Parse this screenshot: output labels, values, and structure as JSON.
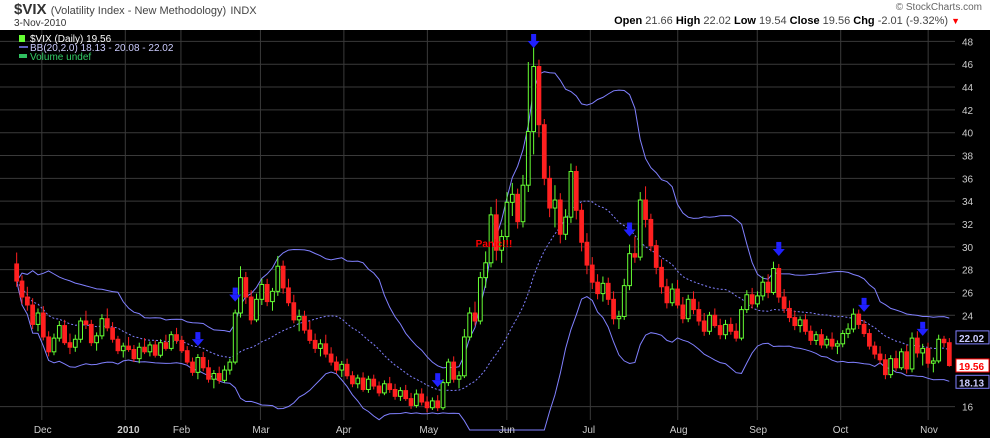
{
  "header": {
    "symbol": "$VIX",
    "name": "(Volatility Index - New Methodology)",
    "exchange": "INDX",
    "date": "3-Nov-2010",
    "copyright": "© StockCharts.com",
    "open_label": "Open",
    "open": "21.66",
    "high_label": "High",
    "high": "22.02",
    "low_label": "Low",
    "low": "19.54",
    "close_label": "Close",
    "close": "19.56",
    "chg_label": "Chg",
    "chg": "-2.01 (-9.32%)"
  },
  "legend": {
    "vix": "$VIX (Daily) 19.56",
    "bb": "BB(20,2.0) 18.13 - 20.08 - 22.02",
    "volume": "Volume undef"
  },
  "colors": {
    "background": "#000000",
    "grid": "#3a3a3a",
    "up": "#66ff33",
    "down": "#ff2020",
    "band": "#8080ff",
    "mid": "#8080ff",
    "arrow": "#2020ff",
    "annotation": "#ff0000",
    "axis_text": "#cccccc"
  },
  "chart_data": {
    "type": "candlestick",
    "title": "$VIX (Daily)",
    "ylim": [
      15,
      49
    ],
    "ticks_y": [
      16,
      24,
      26,
      28,
      30,
      32,
      34,
      36,
      38,
      40,
      42,
      44,
      46,
      48
    ],
    "months": [
      "Dec",
      "2010",
      "Feb",
      "Mar",
      "Apr",
      "May",
      "Jun",
      "Jul",
      "Aug",
      "Sep",
      "Oct",
      "Nov"
    ],
    "series": [
      {
        "name": "$VIX",
        "ohlc": [
          [
            28.5,
            29.5,
            26.5,
            27.0
          ],
          [
            27.0,
            27.5,
            25.0,
            25.6
          ],
          [
            25.6,
            26.5,
            24.4,
            24.9
          ],
          [
            24.9,
            25.5,
            22.8,
            23.2
          ],
          [
            23.2,
            24.6,
            22.6,
            24.2
          ],
          [
            24.2,
            24.8,
            21.8,
            22.1
          ],
          [
            22.1,
            22.6,
            20.4,
            20.8
          ],
          [
            20.8,
            22.4,
            20.5,
            22.0
          ],
          [
            22.0,
            23.5,
            21.7,
            23.1
          ],
          [
            23.1,
            23.6,
            21.4,
            21.6
          ],
          [
            21.6,
            22.4,
            20.6,
            21.2
          ],
          [
            21.2,
            22.3,
            20.8,
            21.9
          ],
          [
            21.9,
            23.8,
            21.6,
            23.5
          ],
          [
            23.5,
            24.4,
            22.8,
            23.2
          ],
          [
            23.2,
            23.6,
            21.3,
            21.6
          ],
          [
            21.6,
            22.5,
            20.9,
            22.2
          ],
          [
            22.2,
            24.1,
            21.9,
            23.7
          ],
          [
            23.7,
            24.6,
            22.6,
            22.9
          ],
          [
            22.9,
            23.4,
            21.6,
            21.9
          ],
          [
            21.9,
            22.2,
            20.6,
            20.9
          ],
          [
            20.9,
            21.6,
            20.3,
            21.3
          ],
          [
            21.3,
            22.1,
            20.8,
            21.0
          ],
          [
            21.0,
            21.4,
            19.9,
            20.2
          ],
          [
            20.2,
            21.6,
            19.8,
            21.2
          ],
          [
            21.2,
            22.0,
            20.6,
            20.8
          ],
          [
            20.8,
            21.7,
            20.4,
            21.4
          ],
          [
            21.4,
            21.8,
            20.3,
            20.5
          ],
          [
            20.5,
            21.9,
            20.3,
            21.6
          ],
          [
            21.6,
            22.3,
            20.9,
            21.1
          ],
          [
            21.1,
            22.6,
            20.9,
            22.3
          ],
          [
            22.3,
            22.9,
            21.5,
            21.8
          ],
          [
            21.8,
            22.2,
            20.7,
            20.9
          ],
          [
            20.9,
            21.3,
            19.7,
            19.9
          ],
          [
            19.9,
            20.3,
            18.7,
            19.0
          ],
          [
            19.0,
            20.6,
            18.4,
            20.3
          ],
          [
            20.3,
            20.8,
            19.1,
            19.4
          ],
          [
            19.4,
            20.1,
            18.1,
            18.4
          ],
          [
            18.4,
            19.2,
            17.6,
            18.9
          ],
          [
            18.9,
            19.5,
            18.0,
            18.3
          ],
          [
            18.3,
            19.6,
            18.1,
            19.2
          ],
          [
            19.2,
            20.2,
            18.8,
            19.9
          ],
          [
            19.9,
            24.5,
            19.7,
            24.2
          ],
          [
            24.2,
            28.3,
            23.8,
            27.3
          ],
          [
            27.3,
            27.8,
            25.0,
            25.6
          ],
          [
            25.6,
            26.2,
            23.2,
            23.6
          ],
          [
            23.6,
            25.9,
            23.4,
            25.4
          ],
          [
            25.4,
            27.2,
            24.9,
            26.7
          ],
          [
            26.7,
            27.2,
            24.8,
            25.2
          ],
          [
            25.2,
            26.4,
            24.4,
            26.1
          ],
          [
            26.1,
            29.2,
            25.7,
            28.3
          ],
          [
            28.3,
            28.8,
            25.9,
            26.4
          ],
          [
            26.4,
            27.2,
            24.8,
            25.1
          ],
          [
            25.1,
            25.8,
            23.3,
            23.6
          ],
          [
            23.6,
            24.5,
            22.6,
            23.9
          ],
          [
            23.9,
            24.4,
            22.4,
            22.7
          ],
          [
            22.7,
            23.5,
            21.5,
            21.8
          ],
          [
            21.8,
            22.4,
            20.7,
            21.1
          ],
          [
            21.1,
            21.9,
            20.4,
            21.5
          ],
          [
            21.5,
            22.3,
            20.3,
            20.6
          ],
          [
            20.6,
            21.2,
            19.6,
            19.9
          ],
          [
            19.9,
            20.4,
            18.9,
            19.2
          ],
          [
            19.2,
            20.0,
            18.6,
            19.7
          ],
          [
            19.7,
            20.2,
            18.4,
            18.7
          ],
          [
            18.7,
            19.1,
            17.7,
            18.0
          ],
          [
            18.0,
            18.8,
            17.6,
            18.5
          ],
          [
            18.5,
            19.0,
            17.3,
            17.5
          ],
          [
            17.5,
            18.7,
            17.2,
            18.4
          ],
          [
            18.4,
            18.8,
            17.5,
            17.8
          ],
          [
            17.8,
            18.2,
            16.9,
            17.2
          ],
          [
            17.2,
            18.3,
            17.0,
            18.0
          ],
          [
            18.0,
            18.6,
            17.2,
            17.5
          ],
          [
            17.5,
            18.0,
            16.6,
            16.9
          ],
          [
            16.9,
            17.7,
            16.5,
            17.4
          ],
          [
            17.4,
            17.9,
            16.5,
            16.7
          ],
          [
            16.7,
            17.2,
            15.8,
            16.1
          ],
          [
            16.1,
            17.5,
            15.9,
            17.1
          ],
          [
            17.1,
            17.6,
            16.1,
            16.4
          ],
          [
            16.4,
            16.9,
            15.5,
            15.9
          ],
          [
            15.9,
            16.8,
            15.7,
            16.5
          ],
          [
            16.5,
            17.0,
            15.6,
            15.9
          ],
          [
            15.9,
            18.4,
            15.7,
            18.1
          ],
          [
            18.1,
            20.2,
            17.8,
            19.9
          ],
          [
            19.9,
            20.4,
            18.1,
            18.4
          ],
          [
            18.4,
            19.1,
            17.6,
            18.7
          ],
          [
            18.7,
            22.8,
            18.5,
            22.1
          ],
          [
            22.1,
            24.7,
            21.8,
            24.2
          ],
          [
            24.2,
            25.2,
            23.1,
            23.5
          ],
          [
            23.5,
            27.8,
            23.2,
            27.3
          ],
          [
            27.3,
            29.6,
            26.4,
            28.6
          ],
          [
            28.6,
            33.5,
            28.2,
            32.8
          ],
          [
            32.8,
            34.2,
            28.8,
            29.7
          ],
          [
            29.7,
            31.5,
            28.6,
            30.9
          ],
          [
            30.9,
            34.8,
            30.4,
            33.9
          ],
          [
            33.9,
            35.6,
            32.7,
            34.6
          ],
          [
            34.6,
            35.1,
            31.6,
            32.2
          ],
          [
            32.2,
            36.3,
            31.7,
            35.4
          ],
          [
            35.4,
            46.2,
            34.8,
            40.1
          ],
          [
            40.1,
            48.2,
            38.1,
            45.8
          ],
          [
            45.8,
            46.4,
            39.6,
            40.7
          ],
          [
            40.7,
            41.2,
            35.4,
            36.0
          ],
          [
            36.0,
            37.1,
            32.6,
            33.4
          ],
          [
            33.4,
            35.4,
            31.7,
            34.1
          ],
          [
            34.1,
            34.7,
            30.3,
            31.1
          ],
          [
            31.1,
            33.3,
            30.6,
            32.6
          ],
          [
            32.6,
            37.3,
            32.1,
            36.6
          ],
          [
            36.6,
            37.1,
            32.4,
            33.2
          ],
          [
            33.2,
            33.8,
            29.6,
            30.4
          ],
          [
            30.4,
            31.2,
            27.6,
            28.4
          ],
          [
            28.4,
            29.1,
            26.3,
            26.9
          ],
          [
            26.9,
            27.6,
            25.4,
            25.9
          ],
          [
            25.9,
            27.4,
            25.2,
            26.8
          ],
          [
            26.8,
            27.3,
            24.9,
            25.4
          ],
          [
            25.4,
            26.1,
            23.2,
            23.7
          ],
          [
            23.7,
            24.4,
            22.8,
            23.9
          ],
          [
            23.9,
            27.2,
            23.6,
            26.6
          ],
          [
            26.6,
            30.2,
            26.2,
            29.4
          ],
          [
            29.4,
            30.9,
            28.6,
            29.1
          ],
          [
            29.1,
            34.8,
            28.8,
            34.1
          ],
          [
            34.1,
            35.3,
            31.7,
            32.4
          ],
          [
            32.4,
            32.9,
            29.6,
            30.1
          ],
          [
            30.1,
            30.6,
            27.6,
            28.2
          ],
          [
            28.2,
            28.9,
            25.9,
            26.5
          ],
          [
            26.5,
            27.2,
            24.6,
            25.1
          ],
          [
            25.1,
            26.8,
            24.8,
            26.3
          ],
          [
            26.3,
            27.1,
            24.6,
            24.9
          ],
          [
            24.9,
            25.6,
            23.3,
            23.7
          ],
          [
            23.7,
            25.8,
            23.4,
            25.4
          ],
          [
            25.4,
            26.1,
            24.1,
            24.5
          ],
          [
            24.5,
            25.2,
            23.1,
            23.5
          ],
          [
            23.5,
            24.2,
            22.2,
            22.6
          ],
          [
            22.6,
            24.3,
            22.3,
            24.0
          ],
          [
            24.0,
            24.6,
            22.9,
            23.1
          ],
          [
            23.1,
            23.7,
            21.9,
            22.3
          ],
          [
            22.3,
            23.6,
            21.9,
            23.2
          ],
          [
            23.2,
            23.8,
            22.3,
            22.6
          ],
          [
            22.6,
            23.3,
            21.7,
            22.0
          ],
          [
            22.0,
            24.8,
            21.8,
            24.5
          ],
          [
            24.5,
            26.2,
            24.2,
            25.8
          ],
          [
            25.8,
            26.4,
            24.6,
            25.0
          ],
          [
            25.0,
            26.1,
            24.7,
            25.7
          ],
          [
            25.7,
            27.4,
            25.3,
            26.9
          ],
          [
            26.9,
            27.6,
            25.5,
            26.0
          ],
          [
            26.0,
            28.7,
            25.8,
            28.1
          ],
          [
            28.1,
            28.5,
            25.1,
            25.6
          ],
          [
            25.6,
            26.3,
            24.2,
            24.6
          ],
          [
            24.6,
            25.3,
            23.4,
            23.8
          ],
          [
            23.8,
            24.4,
            22.7,
            23.1
          ],
          [
            23.1,
            23.9,
            22.5,
            23.6
          ],
          [
            23.6,
            24.1,
            22.3,
            22.6
          ],
          [
            22.6,
            23.1,
            21.4,
            21.8
          ],
          [
            21.8,
            22.6,
            21.4,
            22.3
          ],
          [
            22.3,
            22.8,
            21.1,
            21.4
          ],
          [
            21.4,
            22.2,
            21.1,
            21.9
          ],
          [
            21.9,
            22.5,
            21.0,
            21.3
          ],
          [
            21.3,
            21.8,
            20.6,
            21.5
          ],
          [
            21.5,
            22.7,
            21.2,
            22.4
          ],
          [
            22.4,
            23.3,
            22.0,
            22.8
          ],
          [
            22.8,
            24.6,
            22.5,
            24.1
          ],
          [
            24.1,
            24.5,
            22.8,
            23.2
          ],
          [
            23.2,
            23.6,
            22.1,
            22.4
          ],
          [
            22.4,
            22.8,
            21.0,
            21.3
          ],
          [
            21.3,
            21.7,
            20.2,
            20.6
          ],
          [
            20.6,
            21.3,
            19.7,
            20.1
          ],
          [
            20.1,
            20.6,
            18.4,
            18.8
          ],
          [
            18.8,
            20.5,
            18.5,
            20.2
          ],
          [
            20.2,
            20.9,
            19.1,
            19.4
          ],
          [
            19.4,
            21.1,
            19.2,
            20.8
          ],
          [
            20.8,
            21.4,
            18.9,
            19.3
          ],
          [
            19.3,
            22.5,
            19.0,
            22.0
          ],
          [
            22.0,
            22.6,
            20.3,
            20.7
          ],
          [
            20.7,
            21.5,
            19.6,
            21.1
          ],
          [
            21.1,
            21.6,
            19.4,
            19.8
          ],
          [
            19.8,
            20.3,
            19.0,
            20.0
          ],
          [
            20.0,
            22.3,
            19.8,
            21.9
          ],
          [
            21.9,
            22.2,
            21.2,
            21.6
          ],
          [
            21.6,
            22.0,
            19.5,
            19.6
          ]
        ]
      }
    ],
    "annotations": [
      {
        "text": "Panic!!!",
        "x_index": 88,
        "y": 30.0
      }
    ],
    "arrows_at_index": [
      34,
      41,
      79,
      97,
      115,
      143,
      159,
      170
    ]
  }
}
